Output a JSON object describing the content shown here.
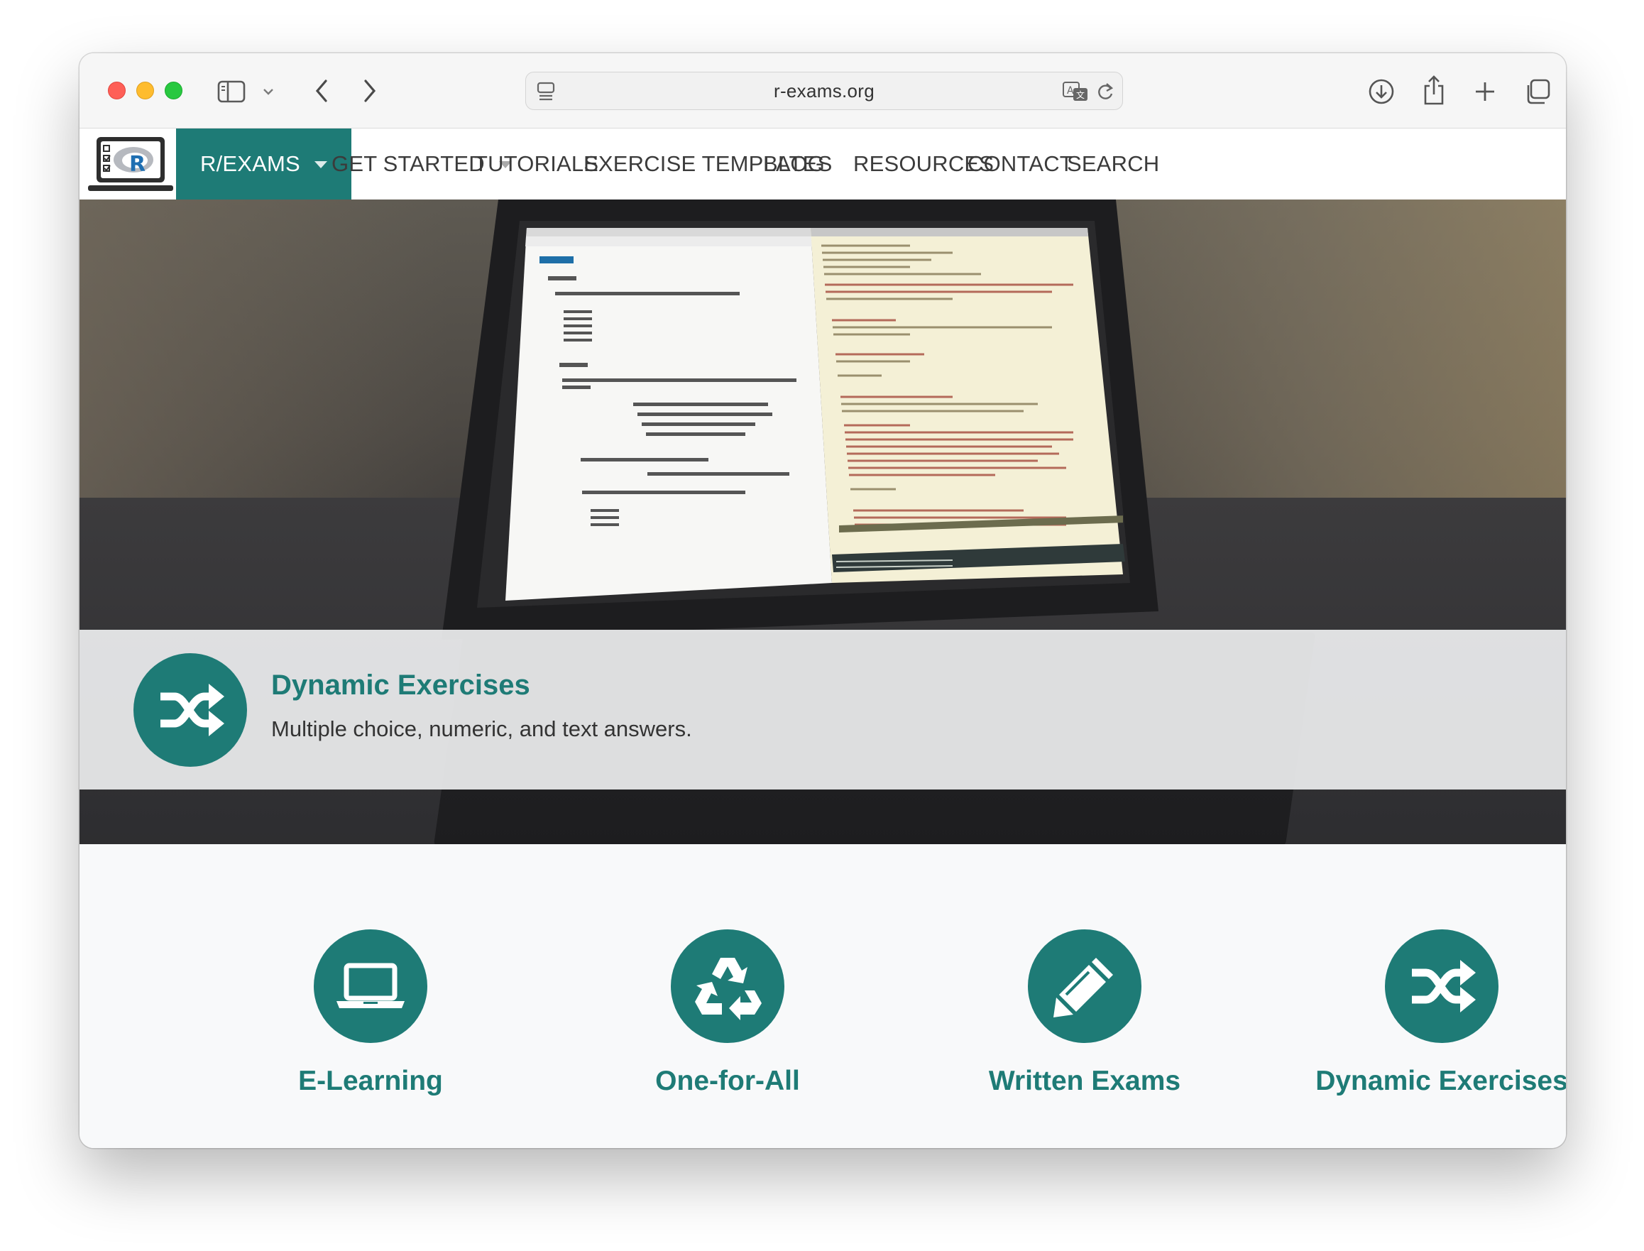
{
  "browser": {
    "url": "r-exams.org"
  },
  "nav": {
    "items": [
      {
        "label": "R/EXAMS",
        "active": true,
        "dropdown": true
      },
      {
        "label": "GET STARTED",
        "active": false,
        "dropdown": true
      },
      {
        "label": "TUTORIALS",
        "active": false,
        "dropdown": false
      },
      {
        "label": "EXERCISE TEMPLATES",
        "active": false,
        "dropdown": false
      },
      {
        "label": "BLOG",
        "active": false,
        "dropdown": false
      },
      {
        "label": "RESOURCES",
        "active": false,
        "dropdown": false
      },
      {
        "label": "CONTACT",
        "active": false,
        "dropdown": false
      },
      {
        "label": "SEARCH",
        "active": false,
        "dropdown": false
      }
    ]
  },
  "hero": {
    "caption_title": "Dynamic Exercises",
    "caption_subtitle": "Multiple choice, numeric, and text answers.",
    "caption_icon": "shuffle-icon"
  },
  "features": [
    {
      "label": "E-Learning",
      "icon": "laptop-icon"
    },
    {
      "label": "One-for-All",
      "icon": "recycle-icon"
    },
    {
      "label": "Written Exams",
      "icon": "pencil-icon"
    },
    {
      "label": "Dynamic Exercises",
      "icon": "shuffle-icon"
    }
  ],
  "colors": {
    "accent": "#1e7b76",
    "nav_text": "#3b3b3b",
    "page_background": "#f8f9fa"
  }
}
